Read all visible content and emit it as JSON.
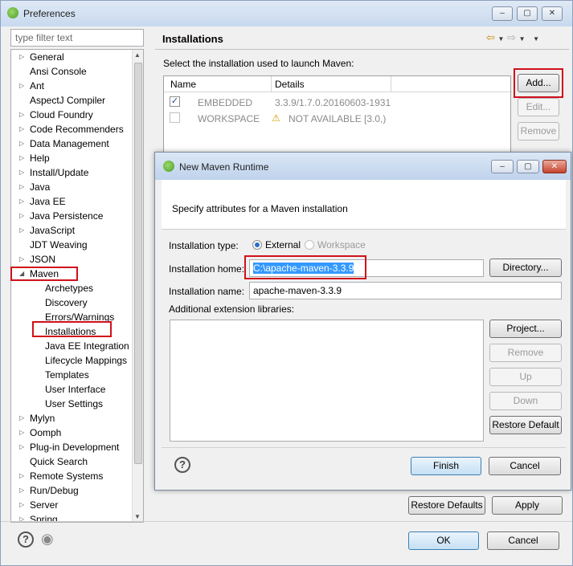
{
  "window": {
    "title": "Preferences",
    "minimize": "‒",
    "maximize": "▢",
    "close": "✕"
  },
  "filter": {
    "placeholder": "type filter text"
  },
  "tree": {
    "items": [
      {
        "label": "General",
        "arrow": "▷"
      },
      {
        "label": "Ansi Console",
        "arrow": ""
      },
      {
        "label": "Ant",
        "arrow": "▷"
      },
      {
        "label": "AspectJ Compiler",
        "arrow": ""
      },
      {
        "label": "Cloud Foundry",
        "arrow": "▷"
      },
      {
        "label": "Code Recommenders",
        "arrow": "▷"
      },
      {
        "label": "Data Management",
        "arrow": "▷"
      },
      {
        "label": "Help",
        "arrow": "▷"
      },
      {
        "label": "Install/Update",
        "arrow": "▷"
      },
      {
        "label": "Java",
        "arrow": "▷"
      },
      {
        "label": "Java EE",
        "arrow": "▷"
      },
      {
        "label": "Java Persistence",
        "arrow": "▷"
      },
      {
        "label": "JavaScript",
        "arrow": "▷"
      },
      {
        "label": "JDT Weaving",
        "arrow": ""
      },
      {
        "label": "JSON",
        "arrow": "▷"
      },
      {
        "label": "Maven",
        "arrow": "◢"
      },
      {
        "label": "Archetypes",
        "arrow": ""
      },
      {
        "label": "Discovery",
        "arrow": ""
      },
      {
        "label": "Errors/Warnings",
        "arrow": ""
      },
      {
        "label": "Installations",
        "arrow": ""
      },
      {
        "label": "Java EE Integration",
        "arrow": ""
      },
      {
        "label": "Lifecycle Mappings",
        "arrow": ""
      },
      {
        "label": "Templates",
        "arrow": ""
      },
      {
        "label": "User Interface",
        "arrow": ""
      },
      {
        "label": "User Settings",
        "arrow": ""
      },
      {
        "label": "Mylyn",
        "arrow": "▷"
      },
      {
        "label": "Oomph",
        "arrow": "▷"
      },
      {
        "label": "Plug-in Development",
        "arrow": "▷"
      },
      {
        "label": "Quick Search",
        "arrow": ""
      },
      {
        "label": "Remote Systems",
        "arrow": "▷"
      },
      {
        "label": "Run/Debug",
        "arrow": "▷"
      },
      {
        "label": "Server",
        "arrow": "▷"
      },
      {
        "label": "Spring",
        "arrow": "▷"
      }
    ]
  },
  "page": {
    "title": "Installations",
    "nav_back": "⇦",
    "nav_forward": "⇨",
    "dropdown": "▼",
    "menu": "▼",
    "description": "Select the installation used to launch Maven:",
    "columns": {
      "name": "Name",
      "details": "Details"
    },
    "rows": [
      {
        "checked": "✓",
        "name": "EMBEDDED",
        "details": "3.3.9/1.7.0.20160603-1931",
        "warning": ""
      },
      {
        "checked": "",
        "name": "WORKSPACE",
        "details": "NOT AVAILABLE [3.0,)",
        "warning": "⚠"
      }
    ],
    "add": "Add...",
    "edit": "Edit...",
    "remove": "Remove",
    "restore_defaults": "Restore Defaults",
    "apply": "Apply"
  },
  "dialog": {
    "title": "New Maven Runtime",
    "header": "Specify attributes for a Maven installation",
    "type_label": "Installation type:",
    "type_external": "External",
    "type_workspace": "Workspace",
    "home_label": "Installation home:",
    "home_value": "C:\\apache-maven-3.3.9",
    "directory": "Directory...",
    "name_label": "Installation name:",
    "name_value": "apache-maven-3.3.9",
    "ext_label": "Additional extension libraries:",
    "project": "Project...",
    "remove": "Remove",
    "up": "Up",
    "down": "Down",
    "restore_default": "Restore Default",
    "finish": "Finish",
    "cancel": "Cancel",
    "help": "?"
  },
  "footer": {
    "ok": "OK",
    "cancel": "Cancel",
    "help": "?",
    "record": "◉"
  }
}
